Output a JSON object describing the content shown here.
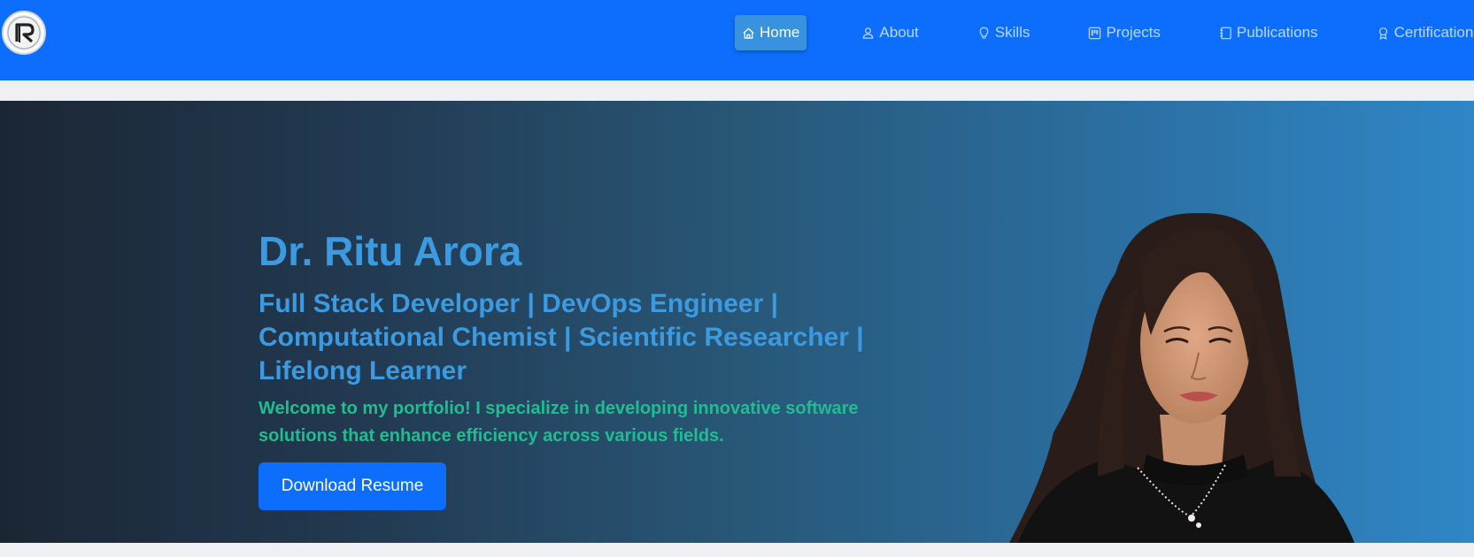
{
  "nav": {
    "items": [
      {
        "label": "Home",
        "icon": "home-icon",
        "active": true
      },
      {
        "label": "About",
        "icon": "user-icon",
        "active": false
      },
      {
        "label": "Skills",
        "icon": "lightbulb-icon",
        "active": false
      },
      {
        "label": "Projects",
        "icon": "kanban-icon",
        "active": false
      },
      {
        "label": "Publications",
        "icon": "journal-icon",
        "active": false
      },
      {
        "label": "Certifications",
        "icon": "award-icon",
        "active": false
      }
    ]
  },
  "hero": {
    "name": "Dr. Ritu Arora",
    "subtitle": "Full Stack Developer | DevOps Engineer | Computational Chemist | Scientific Researcher | Lifelong Learner",
    "welcome": "Welcome to my portfolio! I specialize in developing innovative software solutions that enhance efficiency across various fields.",
    "button_label": "Download Resume"
  },
  "colors": {
    "navbar": "#0d6efd",
    "active_nav": "#3892dd",
    "heading": "#3b9ae0",
    "welcome": "#1fbd90",
    "button": "#0d6efd"
  }
}
